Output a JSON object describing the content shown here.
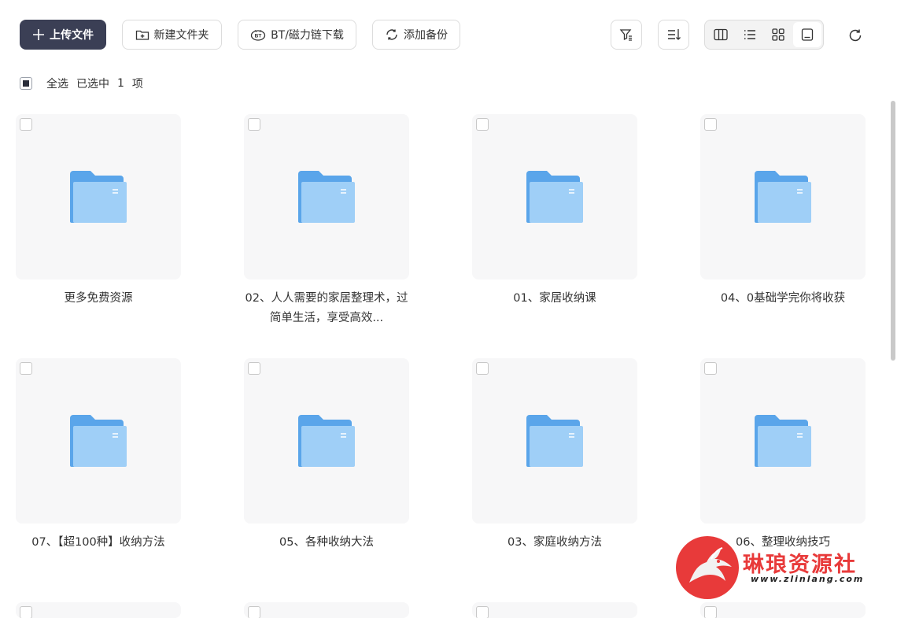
{
  "toolbar": {
    "upload_label": "上传文件",
    "new_folder_label": "新建文件夹",
    "bt_label": "BT/磁力链下载",
    "backup_label": "添加备份",
    "bt_icon_text": "BT"
  },
  "selection": {
    "select_all_label": "全选",
    "selected_prefix": "已选中",
    "selected_count": "1",
    "selected_suffix": "项"
  },
  "files": [
    {
      "name": "更多免费资源",
      "type": "folder"
    },
    {
      "name": "02、人人需要的家居整理术，过简单生活，享受高效...",
      "type": "folder"
    },
    {
      "name": "01、家居收纳课",
      "type": "folder"
    },
    {
      "name": "04、0基础学完你将收获",
      "type": "folder"
    },
    {
      "name": "07、【超100种】收纳方法",
      "type": "folder"
    },
    {
      "name": "05、各种收纳大法",
      "type": "folder"
    },
    {
      "name": "03、家庭收纳方法",
      "type": "folder"
    },
    {
      "name": "06、整理收纳技巧",
      "type": "folder"
    }
  ],
  "watermark": {
    "title": "琳琅资源社",
    "url": "www.zlinlang.com"
  },
  "colors": {
    "primary_button": "#3b3f55",
    "folder_blue": "#6ab0f0",
    "card_bg": "#f7f7f8",
    "watermark_red": "#e83a3a"
  }
}
